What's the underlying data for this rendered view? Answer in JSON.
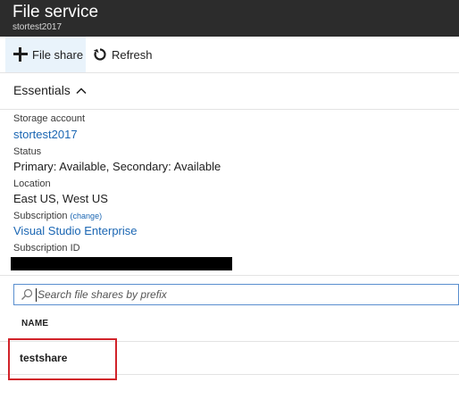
{
  "header": {
    "title": "File service",
    "subtitle": "stortest2017"
  },
  "toolbar": {
    "file_share_label": "File share",
    "file_share_icon": "plus-icon",
    "refresh_label": "Refresh",
    "refresh_icon": "refresh-icon"
  },
  "essentials": {
    "label": "Essentials",
    "toggle_icon": "chevron-up-icon",
    "expanded": true
  },
  "properties": {
    "storage_account_label": "Storage account",
    "storage_account_value": "stortest2017",
    "status_label": "Status",
    "status_value": "Primary: Available, Secondary: Available",
    "location_label": "Location",
    "location_value": "East US, West US",
    "subscription_label": "Subscription",
    "subscription_change": "(change)",
    "subscription_value": "Visual Studio Enterprise",
    "subscription_id_label": "Subscription ID"
  },
  "search": {
    "placeholder": "Search file shares by prefix",
    "value": ""
  },
  "table": {
    "columns": [
      "NAME"
    ],
    "rows": [
      {
        "name": "testshare"
      }
    ]
  },
  "colors": {
    "title_bar": "#2c2c2c",
    "link": "#1a66b3",
    "selected_toolbar": "#e9f3fb",
    "highlight": "#d1232a",
    "search_border": "#5a8fcf"
  }
}
